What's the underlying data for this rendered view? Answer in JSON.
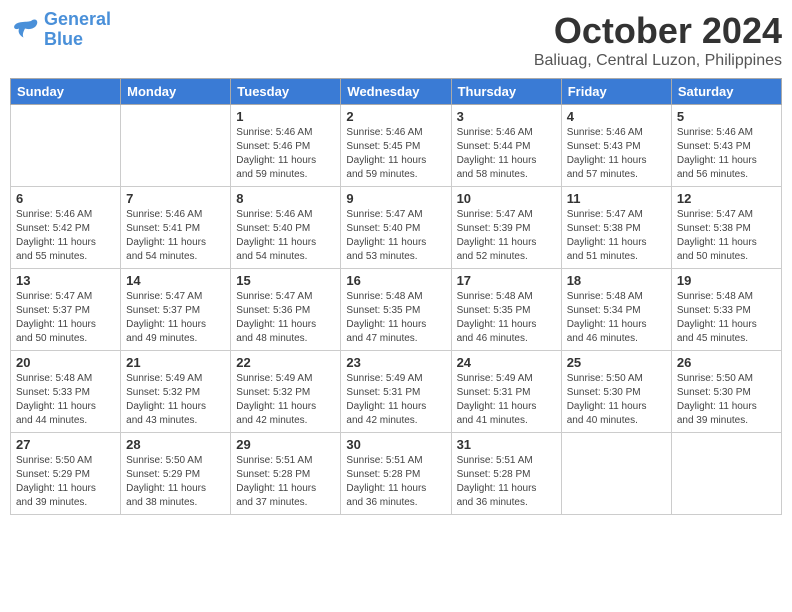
{
  "header": {
    "logo_line1": "General",
    "logo_line2": "Blue",
    "month": "October 2024",
    "location": "Baliuag, Central Luzon, Philippines"
  },
  "days_of_week": [
    "Sunday",
    "Monday",
    "Tuesday",
    "Wednesday",
    "Thursday",
    "Friday",
    "Saturday"
  ],
  "weeks": [
    [
      {
        "day": "",
        "sunrise": "",
        "sunset": "",
        "daylight": "",
        "empty": true
      },
      {
        "day": "",
        "sunrise": "",
        "sunset": "",
        "daylight": "",
        "empty": true
      },
      {
        "day": "1",
        "sunrise": "Sunrise: 5:46 AM",
        "sunset": "Sunset: 5:46 PM",
        "daylight": "Daylight: 11 hours and 59 minutes."
      },
      {
        "day": "2",
        "sunrise": "Sunrise: 5:46 AM",
        "sunset": "Sunset: 5:45 PM",
        "daylight": "Daylight: 11 hours and 59 minutes."
      },
      {
        "day": "3",
        "sunrise": "Sunrise: 5:46 AM",
        "sunset": "Sunset: 5:44 PM",
        "daylight": "Daylight: 11 hours and 58 minutes."
      },
      {
        "day": "4",
        "sunrise": "Sunrise: 5:46 AM",
        "sunset": "Sunset: 5:43 PM",
        "daylight": "Daylight: 11 hours and 57 minutes."
      },
      {
        "day": "5",
        "sunrise": "Sunrise: 5:46 AM",
        "sunset": "Sunset: 5:43 PM",
        "daylight": "Daylight: 11 hours and 56 minutes."
      }
    ],
    [
      {
        "day": "6",
        "sunrise": "Sunrise: 5:46 AM",
        "sunset": "Sunset: 5:42 PM",
        "daylight": "Daylight: 11 hours and 55 minutes."
      },
      {
        "day": "7",
        "sunrise": "Sunrise: 5:46 AM",
        "sunset": "Sunset: 5:41 PM",
        "daylight": "Daylight: 11 hours and 54 minutes."
      },
      {
        "day": "8",
        "sunrise": "Sunrise: 5:46 AM",
        "sunset": "Sunset: 5:40 PM",
        "daylight": "Daylight: 11 hours and 54 minutes."
      },
      {
        "day": "9",
        "sunrise": "Sunrise: 5:47 AM",
        "sunset": "Sunset: 5:40 PM",
        "daylight": "Daylight: 11 hours and 53 minutes."
      },
      {
        "day": "10",
        "sunrise": "Sunrise: 5:47 AM",
        "sunset": "Sunset: 5:39 PM",
        "daylight": "Daylight: 11 hours and 52 minutes."
      },
      {
        "day": "11",
        "sunrise": "Sunrise: 5:47 AM",
        "sunset": "Sunset: 5:38 PM",
        "daylight": "Daylight: 11 hours and 51 minutes."
      },
      {
        "day": "12",
        "sunrise": "Sunrise: 5:47 AM",
        "sunset": "Sunset: 5:38 PM",
        "daylight": "Daylight: 11 hours and 50 minutes."
      }
    ],
    [
      {
        "day": "13",
        "sunrise": "Sunrise: 5:47 AM",
        "sunset": "Sunset: 5:37 PM",
        "daylight": "Daylight: 11 hours and 50 minutes."
      },
      {
        "day": "14",
        "sunrise": "Sunrise: 5:47 AM",
        "sunset": "Sunset: 5:37 PM",
        "daylight": "Daylight: 11 hours and 49 minutes."
      },
      {
        "day": "15",
        "sunrise": "Sunrise: 5:47 AM",
        "sunset": "Sunset: 5:36 PM",
        "daylight": "Daylight: 11 hours and 48 minutes."
      },
      {
        "day": "16",
        "sunrise": "Sunrise: 5:48 AM",
        "sunset": "Sunset: 5:35 PM",
        "daylight": "Daylight: 11 hours and 47 minutes."
      },
      {
        "day": "17",
        "sunrise": "Sunrise: 5:48 AM",
        "sunset": "Sunset: 5:35 PM",
        "daylight": "Daylight: 11 hours and 46 minutes."
      },
      {
        "day": "18",
        "sunrise": "Sunrise: 5:48 AM",
        "sunset": "Sunset: 5:34 PM",
        "daylight": "Daylight: 11 hours and 46 minutes."
      },
      {
        "day": "19",
        "sunrise": "Sunrise: 5:48 AM",
        "sunset": "Sunset: 5:33 PM",
        "daylight": "Daylight: 11 hours and 45 minutes."
      }
    ],
    [
      {
        "day": "20",
        "sunrise": "Sunrise: 5:48 AM",
        "sunset": "Sunset: 5:33 PM",
        "daylight": "Daylight: 11 hours and 44 minutes."
      },
      {
        "day": "21",
        "sunrise": "Sunrise: 5:49 AM",
        "sunset": "Sunset: 5:32 PM",
        "daylight": "Daylight: 11 hours and 43 minutes."
      },
      {
        "day": "22",
        "sunrise": "Sunrise: 5:49 AM",
        "sunset": "Sunset: 5:32 PM",
        "daylight": "Daylight: 11 hours and 42 minutes."
      },
      {
        "day": "23",
        "sunrise": "Sunrise: 5:49 AM",
        "sunset": "Sunset: 5:31 PM",
        "daylight": "Daylight: 11 hours and 42 minutes."
      },
      {
        "day": "24",
        "sunrise": "Sunrise: 5:49 AM",
        "sunset": "Sunset: 5:31 PM",
        "daylight": "Daylight: 11 hours and 41 minutes."
      },
      {
        "day": "25",
        "sunrise": "Sunrise: 5:50 AM",
        "sunset": "Sunset: 5:30 PM",
        "daylight": "Daylight: 11 hours and 40 minutes."
      },
      {
        "day": "26",
        "sunrise": "Sunrise: 5:50 AM",
        "sunset": "Sunset: 5:30 PM",
        "daylight": "Daylight: 11 hours and 39 minutes."
      }
    ],
    [
      {
        "day": "27",
        "sunrise": "Sunrise: 5:50 AM",
        "sunset": "Sunset: 5:29 PM",
        "daylight": "Daylight: 11 hours and 39 minutes."
      },
      {
        "day": "28",
        "sunrise": "Sunrise: 5:50 AM",
        "sunset": "Sunset: 5:29 PM",
        "daylight": "Daylight: 11 hours and 38 minutes."
      },
      {
        "day": "29",
        "sunrise": "Sunrise: 5:51 AM",
        "sunset": "Sunset: 5:28 PM",
        "daylight": "Daylight: 11 hours and 37 minutes."
      },
      {
        "day": "30",
        "sunrise": "Sunrise: 5:51 AM",
        "sunset": "Sunset: 5:28 PM",
        "daylight": "Daylight: 11 hours and 36 minutes."
      },
      {
        "day": "31",
        "sunrise": "Sunrise: 5:51 AM",
        "sunset": "Sunset: 5:28 PM",
        "daylight": "Daylight: 11 hours and 36 minutes."
      },
      {
        "day": "",
        "sunrise": "",
        "sunset": "",
        "daylight": "",
        "empty": true
      },
      {
        "day": "",
        "sunrise": "",
        "sunset": "",
        "daylight": "",
        "empty": true
      }
    ]
  ]
}
